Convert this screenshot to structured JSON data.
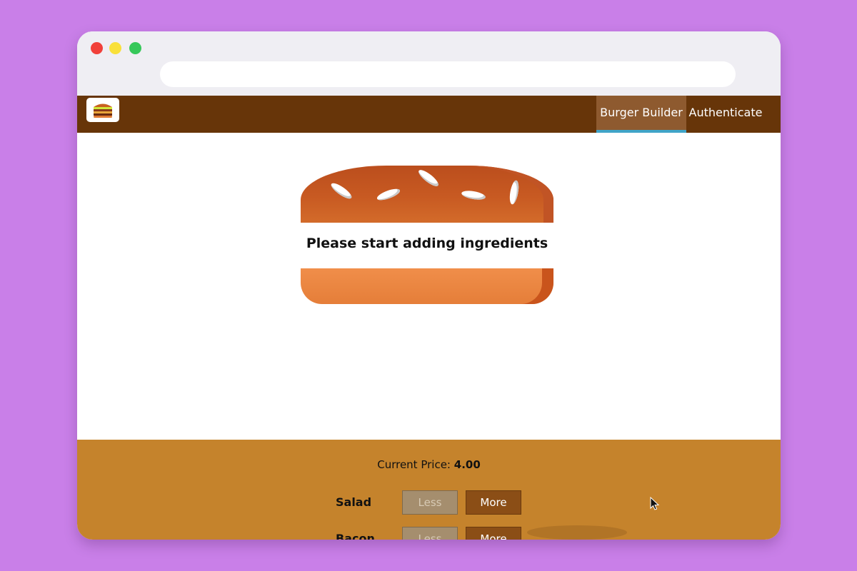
{
  "nav": {
    "items": [
      {
        "label": "Burger Builder",
        "active": true
      },
      {
        "label": "Authenticate",
        "active": false
      }
    ]
  },
  "burger": {
    "message": "Please start adding ingredients"
  },
  "controls": {
    "price_label": "Current Price:",
    "price_value": "4.00",
    "rows": [
      {
        "label": "Salad",
        "less": "Less",
        "more": "More"
      },
      {
        "label": "Bacon",
        "less": "Less",
        "more": "More"
      }
    ]
  },
  "colors": {
    "background": "#c97fe8",
    "toolbar": "#673509",
    "active_tab": "#8e5a2f",
    "active_indicator": "#40a4c8",
    "controls_bg": "#c5832c",
    "more_button": "#8b4e16",
    "less_button": "#a58e6e"
  },
  "icons": {
    "logo": "burger-logo-icon",
    "cursor": "mouse-cursor-icon"
  }
}
